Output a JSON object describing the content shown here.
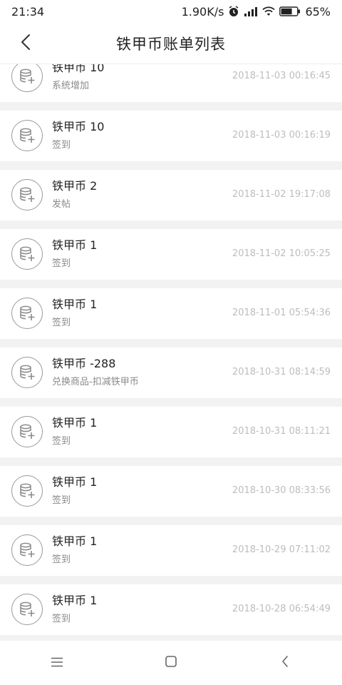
{
  "status": {
    "time": "21:34",
    "speed": "1.90K/s",
    "battery": "65%"
  },
  "header": {
    "title": "铁甲币账单列表",
    "back_icon": "chevron-left-icon"
  },
  "records": [
    {
      "amount": "铁甲币 10",
      "reason": "系统增加",
      "time": "2018-11-03 00:16:45"
    },
    {
      "amount": "铁甲币 10",
      "reason": "签到",
      "time": "2018-11-03 00:16:19"
    },
    {
      "amount": "铁甲币 2",
      "reason": "发帖",
      "time": "2018-11-02 19:17:08"
    },
    {
      "amount": "铁甲币 1",
      "reason": "签到",
      "time": "2018-11-02 10:05:25"
    },
    {
      "amount": "铁甲币 1",
      "reason": "签到",
      "time": "2018-11-01 05:54:36"
    },
    {
      "amount": "铁甲币 -288",
      "reason": "兑换商品-扣减铁甲币",
      "time": "2018-10-31 08:14:59"
    },
    {
      "amount": "铁甲币 1",
      "reason": "签到",
      "time": "2018-10-31 08:11:21"
    },
    {
      "amount": "铁甲币 1",
      "reason": "签到",
      "time": "2018-10-30 08:33:56"
    },
    {
      "amount": "铁甲币 1",
      "reason": "签到",
      "time": "2018-10-29 07:11:02"
    },
    {
      "amount": "铁甲币 1",
      "reason": "签到",
      "time": "2018-10-28 06:54:49"
    }
  ],
  "nav": {
    "menu_icon": "menu-icon",
    "home_icon": "square-home-icon",
    "back_icon": "chevron-left-icon"
  }
}
